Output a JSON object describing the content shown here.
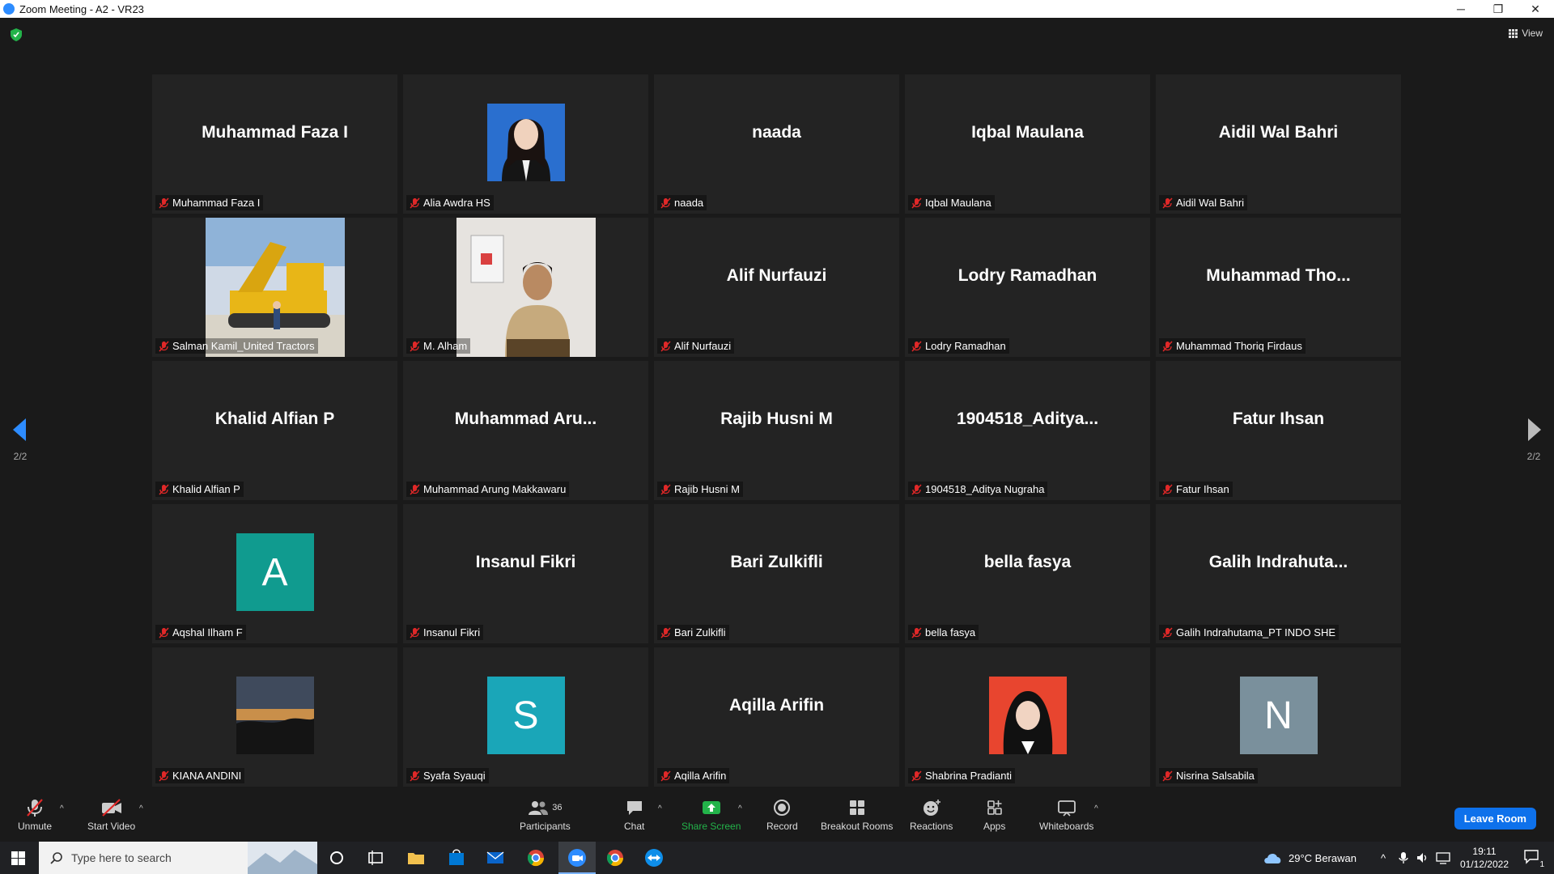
{
  "window": {
    "title": "Zoom Meeting - A2 - VR23",
    "minimize": "─",
    "restore": "❐",
    "close": "✕"
  },
  "top": {
    "view_label": "View"
  },
  "pager": {
    "left": "2/2",
    "right": "2/2"
  },
  "tiles": [
    {
      "big": "Muhammad Faza I",
      "name": "Muhammad Faza I"
    },
    {
      "big": "",
      "name": "Alia Awdra HS"
    },
    {
      "big": "naada",
      "name": "naada"
    },
    {
      "big": "Iqbal Maulana",
      "name": "Iqbal Maulana"
    },
    {
      "big": "Aidil Wal Bahri",
      "name": "Aidil Wal Bahri"
    },
    {
      "big": "",
      "name": "Salman Kamil_United Tractors"
    },
    {
      "big": "",
      "name": "M. Alham"
    },
    {
      "big": "Alif Nurfauzi",
      "name": "Alif Nurfauzi"
    },
    {
      "big": "Lodry Ramadhan",
      "name": "Lodry Ramadhan"
    },
    {
      "big": "Muhammad  Tho...",
      "name": "Muhammad Thoriq Firdaus"
    },
    {
      "big": "Khalid Alfian P",
      "name": "Khalid Alfian P"
    },
    {
      "big": "Muhammad  Aru...",
      "name": "Muhammad Arung Makkawaru"
    },
    {
      "big": "Rajib Husni M",
      "name": "Rajib Husni M"
    },
    {
      "big": "1904518_Aditya...",
      "name": "1904518_Aditya Nugraha"
    },
    {
      "big": "Fatur Ihsan",
      "name": "Fatur Ihsan"
    },
    {
      "big": "A",
      "name": "Aqshal Ilham F"
    },
    {
      "big": "Insanul Fikri",
      "name": "Insanul Fikri"
    },
    {
      "big": "Bari Zulkifli",
      "name": "Bari Zulkifli"
    },
    {
      "big": "bella fasya",
      "name": "bella fasya"
    },
    {
      "big": "Galih  Indrahuta...",
      "name": "Galih Indrahutama_PT INDO SHE"
    },
    {
      "big": "",
      "name": "KIANA ANDINI"
    },
    {
      "big": "S",
      "name": "Syafa Syauqi"
    },
    {
      "big": "Aqilla Arifin",
      "name": "Aqilla Arifin"
    },
    {
      "big": "",
      "name": "Shabrina Pradianti"
    },
    {
      "big": "N",
      "name": "Nisrina Salsabila"
    }
  ],
  "avatar_colors": {
    "A": "#109b8f",
    "S": "#1aa6b8",
    "N": "#7a909c"
  },
  "toolbar": {
    "unmute": "Unmute",
    "start_video": "Start Video",
    "participants": "Participants",
    "participants_count": "36",
    "chat": "Chat",
    "share_screen": "Share Screen",
    "record": "Record",
    "breakout_rooms": "Breakout Rooms",
    "reactions": "Reactions",
    "apps": "Apps",
    "whiteboards": "Whiteboards",
    "leave": "Leave Room"
  },
  "taskbar": {
    "search_placeholder": "Type here to search",
    "weather": "29°C  Berawan",
    "time": "19:11",
    "date": "01/12/2022",
    "notification_count": "1"
  },
  "colors": {
    "accent": "#0e71eb",
    "share_green": "#23b34a",
    "muted_red": "#e02828"
  }
}
